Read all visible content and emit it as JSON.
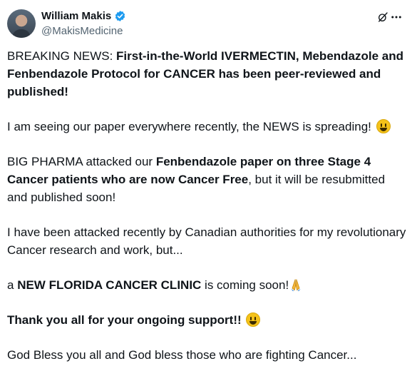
{
  "author": {
    "name": "William Makis",
    "handle": "@MakisMedicine",
    "verified_color": "#1d9bf0"
  },
  "icons": [
    "avatar",
    "verified-badge-icon",
    "grok-icon",
    "more-options-icon",
    "smiley-emoji-icon",
    "praying-hands-emoji-icon"
  ],
  "tweet": {
    "p1_lead": "BREAKING NEWS: ",
    "p1_bold": "First-in-the-World IVERMECTIN, Mebendazole and Fenbendazole Protocol for CANCER has been peer-reviewed and published!",
    "p2": "I am seeing our paper everywhere recently, the NEWS is spreading! ",
    "p3_lead": "BIG PHARMA attacked our ",
    "p3_bold": "Fenbendazole paper on three Stage 4 Cancer patients who are now Cancer Free",
    "p3_tail": ", but it will be resubmitted and published soon!",
    "p4": "I have been attacked recently by Canadian authorities for my revolutionary Cancer research and work, but...",
    "p5_lead": "a ",
    "p5_bold": "NEW FLORIDA CANCER CLINIC",
    "p5_tail": " is coming soon!",
    "p6_bold": "Thank you all for your ongoing support!! ",
    "p7": "God Bless you all and God bless those who are fighting Cancer..."
  }
}
